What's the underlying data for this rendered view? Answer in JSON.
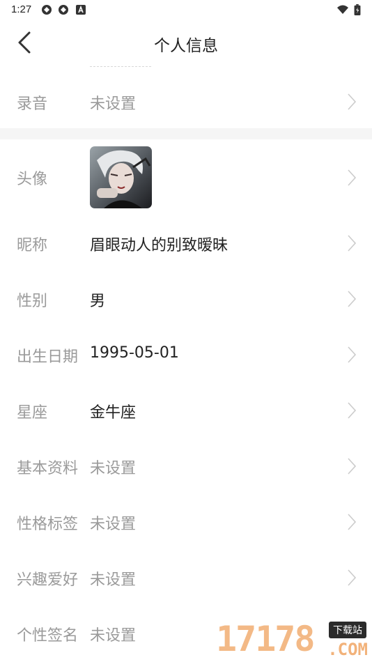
{
  "status_bar": {
    "time": "1:27",
    "left_icons": [
      "sync-icon",
      "sync-icon",
      "a-badge-icon"
    ],
    "right_icons": [
      "wifi-icon",
      "battery-icon"
    ]
  },
  "header": {
    "title": "个人信息",
    "back_icon": "chevron-left-icon"
  },
  "rows": {
    "recording": {
      "label": "录音",
      "value": "未设置"
    },
    "avatar": {
      "label": "头像"
    },
    "nickname": {
      "label": "昵称",
      "value": "眉眼动人的别致暧昧"
    },
    "gender": {
      "label": "性别",
      "value": "男"
    },
    "birthday": {
      "label": "出生日期",
      "value": "1995-05-01"
    },
    "zodiac": {
      "label": "星座",
      "value": "金牛座"
    },
    "basic_info": {
      "label": "基本资料",
      "value": "未设置"
    },
    "personality_tags": {
      "label": "性格标签",
      "value": "未设置"
    },
    "hobbies": {
      "label": "兴趣爱好",
      "value": "未设置"
    },
    "signature": {
      "label": "个性签名",
      "value": "未设置"
    }
  },
  "watermark": {
    "digits": "17178",
    "tag": "下载站",
    "domain": ".COM"
  },
  "colors": {
    "label": "#9a9a9a",
    "value": "#222222",
    "chevron": "#cccccc",
    "divider": "#f5f5f5"
  }
}
